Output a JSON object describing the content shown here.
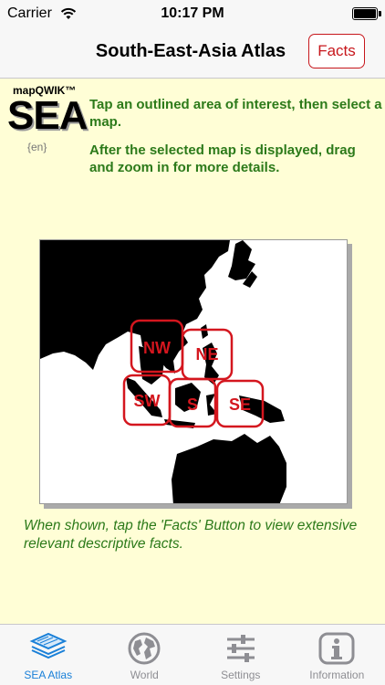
{
  "status_bar": {
    "carrier": "Carrier",
    "time": "10:17 PM"
  },
  "nav": {
    "title": "South-East-Asia Atlas",
    "facts_button": "Facts"
  },
  "logo": {
    "small": "mapQWIK™",
    "big": "SEA",
    "lang": "{en}"
  },
  "instructions": [
    "Tap an outlined area of interest, then select a map.",
    "After the selected map is displayed, drag and zoom in for more details."
  ],
  "map": {
    "regions": [
      {
        "label": "NW"
      },
      {
        "label": "NE"
      },
      {
        "label": "SW"
      },
      {
        "label": "S"
      },
      {
        "label": "SE"
      }
    ],
    "outline_color": "#d4161e"
  },
  "facts_note": "When shown, tap the 'Facts' Button to view extensive relevant descriptive facts.",
  "tabs": [
    {
      "label": "SEA Atlas",
      "icon": "layers-icon",
      "active": true
    },
    {
      "label": "World",
      "icon": "globe-icon",
      "active": false
    },
    {
      "label": "Settings",
      "icon": "sliders-icon",
      "active": false
    },
    {
      "label": "Information",
      "icon": "info-icon",
      "active": false
    }
  ],
  "colors": {
    "accent": "#1a80d8",
    "instruction_text": "#2c7a1a",
    "facts_red": "#c7171c",
    "background": "#fffed6"
  }
}
